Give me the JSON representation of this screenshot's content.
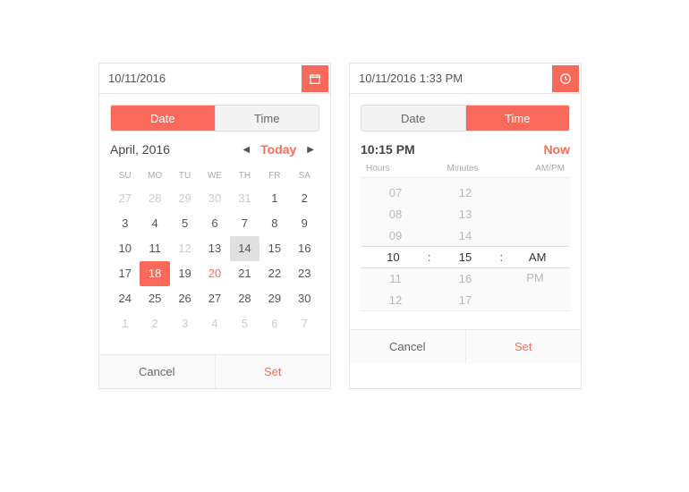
{
  "date_picker": {
    "input_value": "10/11/2016",
    "tabs": {
      "date": "Date",
      "time": "Time"
    },
    "nav": {
      "title": "April, 2016",
      "today": "Today"
    },
    "dow": [
      "SU",
      "MO",
      "TU",
      "WE",
      "TH",
      "FR",
      "SA"
    ],
    "days": [
      {
        "n": "27",
        "cls": "muted"
      },
      {
        "n": "28",
        "cls": "muted"
      },
      {
        "n": "29",
        "cls": "muted"
      },
      {
        "n": "30",
        "cls": "muted"
      },
      {
        "n": "31",
        "cls": "muted"
      },
      {
        "n": "1",
        "cls": ""
      },
      {
        "n": "2",
        "cls": ""
      },
      {
        "n": "3",
        "cls": ""
      },
      {
        "n": "4",
        "cls": ""
      },
      {
        "n": "5",
        "cls": ""
      },
      {
        "n": "6",
        "cls": ""
      },
      {
        "n": "7",
        "cls": ""
      },
      {
        "n": "8",
        "cls": ""
      },
      {
        "n": "9",
        "cls": ""
      },
      {
        "n": "10",
        "cls": ""
      },
      {
        "n": "11",
        "cls": ""
      },
      {
        "n": "12",
        "cls": "muted"
      },
      {
        "n": "13",
        "cls": ""
      },
      {
        "n": "14",
        "cls": "hover"
      },
      {
        "n": "15",
        "cls": ""
      },
      {
        "n": "16",
        "cls": ""
      },
      {
        "n": "17",
        "cls": ""
      },
      {
        "n": "18",
        "cls": "sel"
      },
      {
        "n": "19",
        "cls": ""
      },
      {
        "n": "20",
        "cls": "red"
      },
      {
        "n": "21",
        "cls": ""
      },
      {
        "n": "22",
        "cls": ""
      },
      {
        "n": "23",
        "cls": ""
      },
      {
        "n": "24",
        "cls": ""
      },
      {
        "n": "25",
        "cls": ""
      },
      {
        "n": "26",
        "cls": ""
      },
      {
        "n": "27",
        "cls": ""
      },
      {
        "n": "28",
        "cls": ""
      },
      {
        "n": "29",
        "cls": ""
      },
      {
        "n": "30",
        "cls": ""
      },
      {
        "n": "1",
        "cls": "muted"
      },
      {
        "n": "2",
        "cls": "muted"
      },
      {
        "n": "3",
        "cls": "muted"
      },
      {
        "n": "4",
        "cls": "muted"
      },
      {
        "n": "5",
        "cls": "muted"
      },
      {
        "n": "6",
        "cls": "muted"
      },
      {
        "n": "7",
        "cls": "muted"
      }
    ],
    "footer": {
      "cancel": "Cancel",
      "set": "Set"
    }
  },
  "time_picker": {
    "input_value": "10/11/2016 1:33 PM",
    "tabs": {
      "date": "Date",
      "time": "Time"
    },
    "current": "10:15 PM",
    "now": "Now",
    "cols": {
      "hours": "Hours",
      "minutes": "Minutes",
      "ampm": "AM/PM"
    },
    "hours": [
      "07",
      "08",
      "09",
      "10",
      "11",
      "12"
    ],
    "minutes": [
      "12",
      "13",
      "14",
      "15",
      "16",
      "17"
    ],
    "ampm": [
      "",
      "",
      "",
      "AM",
      "PM",
      ""
    ],
    "sel": {
      "h": "10",
      "m": "15",
      "ap": "AM"
    },
    "footer": {
      "cancel": "Cancel",
      "set": "Set"
    }
  }
}
